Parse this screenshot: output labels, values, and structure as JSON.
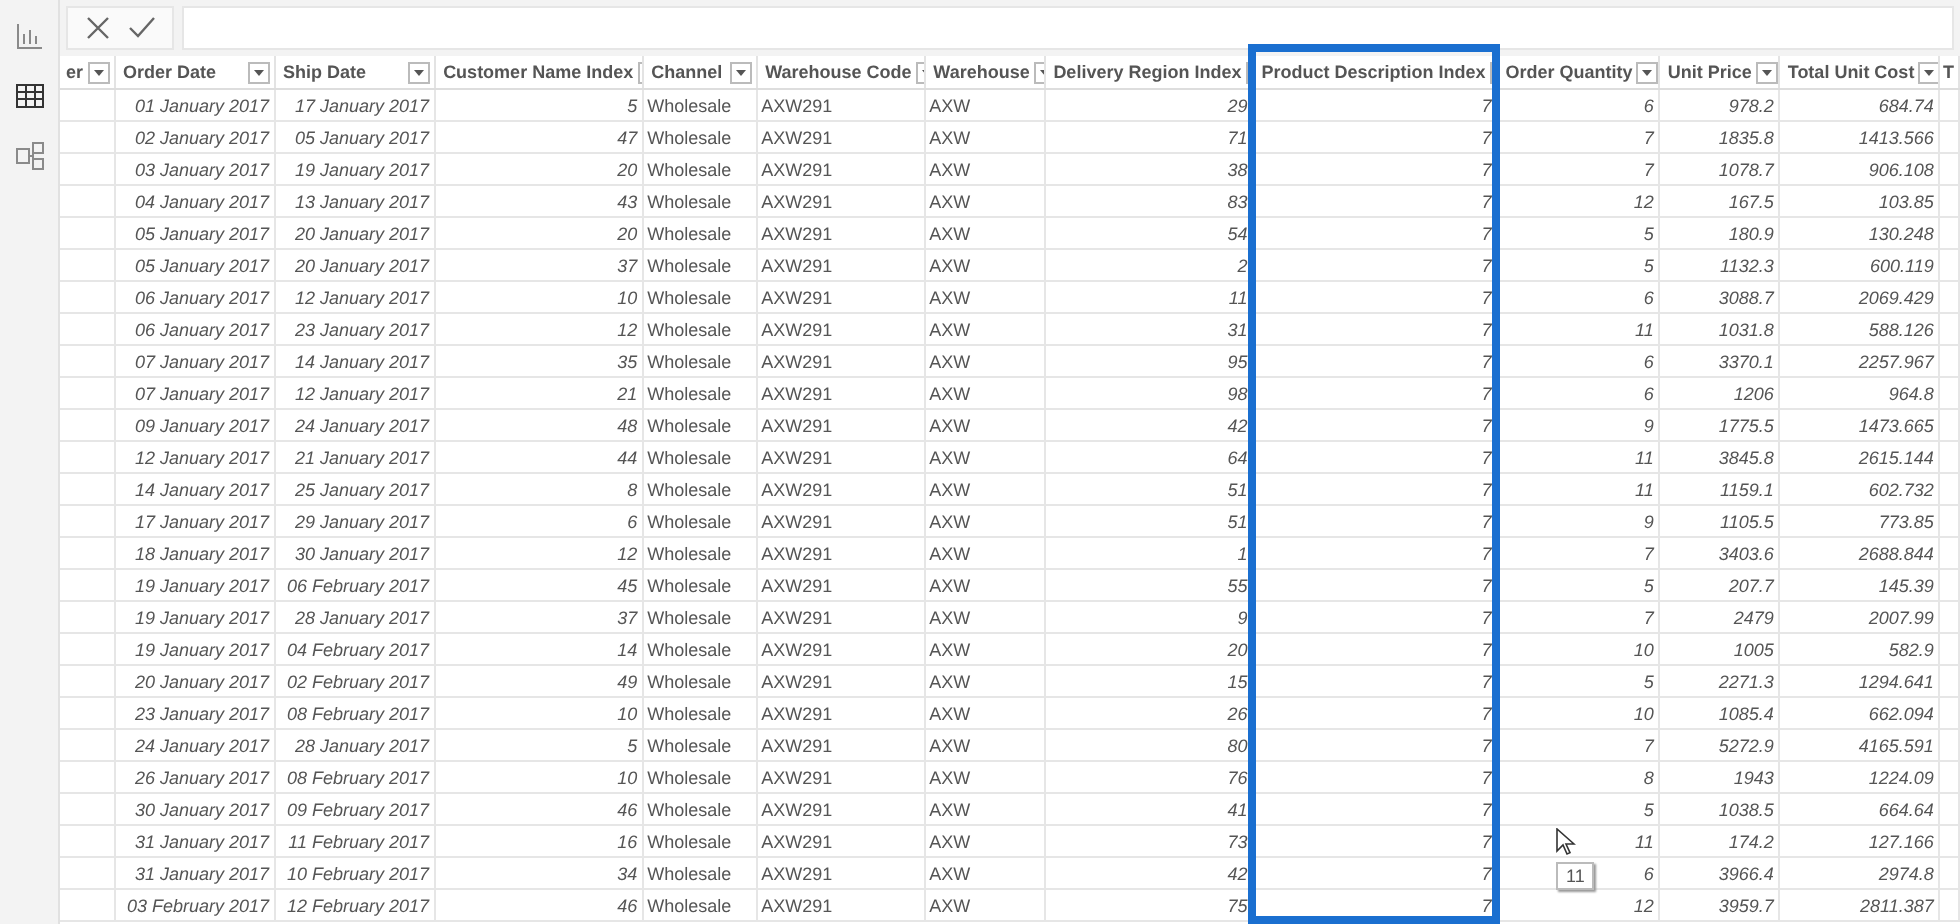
{
  "sidebar": {
    "items": [
      {
        "kind": "report",
        "selected": false
      },
      {
        "kind": "data",
        "selected": true
      },
      {
        "kind": "model",
        "selected": false
      }
    ]
  },
  "formula_bar": {
    "buttons": [
      {
        "kind": "cancel"
      },
      {
        "kind": "commit"
      }
    ]
  },
  "table": {
    "columns": [
      {
        "label": "er",
        "kind": "cut",
        "highlighted": false
      },
      {
        "label": "Order Date",
        "kind": "date",
        "highlighted": false
      },
      {
        "label": "Ship Date",
        "kind": "date",
        "highlighted": false
      },
      {
        "label": "Customer Name Index",
        "kind": "number",
        "highlighted": false
      },
      {
        "label": "Channel",
        "kind": "text",
        "highlighted": false
      },
      {
        "label": "Warehouse Code",
        "kind": "text",
        "highlighted": false
      },
      {
        "label": "Warehouse",
        "kind": "text",
        "highlighted": false
      },
      {
        "label": "Delivery Region Index",
        "kind": "number",
        "highlighted": false
      },
      {
        "label": "Product Description Index",
        "kind": "number",
        "highlighted": true
      },
      {
        "label": "Order Quantity",
        "kind": "number",
        "highlighted": false
      },
      {
        "label": "Unit Price",
        "kind": "number",
        "highlighted": false
      },
      {
        "label": "Total Unit Cost",
        "kind": "number",
        "highlighted": false
      },
      {
        "label": "T",
        "kind": "cut",
        "highlighted": false
      }
    ],
    "rows": [
      [
        "",
        "01 January 2017",
        "17 January 2017",
        "5",
        "Wholesale",
        "AXW291",
        "AXW",
        "29",
        "7",
        "6",
        "978.2",
        "684.74",
        ""
      ],
      [
        "",
        "02 January 2017",
        "05 January 2017",
        "47",
        "Wholesale",
        "AXW291",
        "AXW",
        "71",
        "7",
        "7",
        "1835.8",
        "1413.566",
        ""
      ],
      [
        "",
        "03 January 2017",
        "19 January 2017",
        "20",
        "Wholesale",
        "AXW291",
        "AXW",
        "38",
        "7",
        "7",
        "1078.7",
        "906.108",
        ""
      ],
      [
        "",
        "04 January 2017",
        "13 January 2017",
        "43",
        "Wholesale",
        "AXW291",
        "AXW",
        "83",
        "7",
        "12",
        "167.5",
        "103.85",
        ""
      ],
      [
        "",
        "05 January 2017",
        "20 January 2017",
        "20",
        "Wholesale",
        "AXW291",
        "AXW",
        "54",
        "7",
        "5",
        "180.9",
        "130.248",
        ""
      ],
      [
        "",
        "05 January 2017",
        "20 January 2017",
        "37",
        "Wholesale",
        "AXW291",
        "AXW",
        "2",
        "7",
        "5",
        "1132.3",
        "600.119",
        ""
      ],
      [
        "",
        "06 January 2017",
        "12 January 2017",
        "10",
        "Wholesale",
        "AXW291",
        "AXW",
        "11",
        "7",
        "6",
        "3088.7",
        "2069.429",
        ""
      ],
      [
        "",
        "06 January 2017",
        "23 January 2017",
        "12",
        "Wholesale",
        "AXW291",
        "AXW",
        "31",
        "7",
        "11",
        "1031.8",
        "588.126",
        ""
      ],
      [
        "",
        "07 January 2017",
        "14 January 2017",
        "35",
        "Wholesale",
        "AXW291",
        "AXW",
        "95",
        "7",
        "6",
        "3370.1",
        "2257.967",
        ""
      ],
      [
        "",
        "07 January 2017",
        "12 January 2017",
        "21",
        "Wholesale",
        "AXW291",
        "AXW",
        "98",
        "7",
        "6",
        "1206",
        "964.8",
        ""
      ],
      [
        "",
        "09 January 2017",
        "24 January 2017",
        "48",
        "Wholesale",
        "AXW291",
        "AXW",
        "42",
        "7",
        "9",
        "1775.5",
        "1473.665",
        ""
      ],
      [
        "",
        "12 January 2017",
        "21 January 2017",
        "44",
        "Wholesale",
        "AXW291",
        "AXW",
        "64",
        "7",
        "11",
        "3845.8",
        "2615.144",
        ""
      ],
      [
        "",
        "14 January 2017",
        "25 January 2017",
        "8",
        "Wholesale",
        "AXW291",
        "AXW",
        "51",
        "7",
        "11",
        "1159.1",
        "602.732",
        ""
      ],
      [
        "",
        "17 January 2017",
        "29 January 2017",
        "6",
        "Wholesale",
        "AXW291",
        "AXW",
        "51",
        "7",
        "9",
        "1105.5",
        "773.85",
        ""
      ],
      [
        "",
        "18 January 2017",
        "30 January 2017",
        "12",
        "Wholesale",
        "AXW291",
        "AXW",
        "1",
        "7",
        "7",
        "3403.6",
        "2688.844",
        ""
      ],
      [
        "",
        "19 January 2017",
        "06 February 2017",
        "45",
        "Wholesale",
        "AXW291",
        "AXW",
        "55",
        "7",
        "5",
        "207.7",
        "145.39",
        ""
      ],
      [
        "",
        "19 January 2017",
        "28 January 2017",
        "37",
        "Wholesale",
        "AXW291",
        "AXW",
        "9",
        "7",
        "7",
        "2479",
        "2007.99",
        ""
      ],
      [
        "",
        "19 January 2017",
        "04 February 2017",
        "14",
        "Wholesale",
        "AXW291",
        "AXW",
        "20",
        "7",
        "10",
        "1005",
        "582.9",
        ""
      ],
      [
        "",
        "20 January 2017",
        "02 February 2017",
        "49",
        "Wholesale",
        "AXW291",
        "AXW",
        "15",
        "7",
        "5",
        "2271.3",
        "1294.641",
        ""
      ],
      [
        "",
        "23 January 2017",
        "08 February 2017",
        "10",
        "Wholesale",
        "AXW291",
        "AXW",
        "26",
        "7",
        "10",
        "1085.4",
        "662.094",
        ""
      ],
      [
        "",
        "24 January 2017",
        "28 January 2017",
        "5",
        "Wholesale",
        "AXW291",
        "AXW",
        "80",
        "7",
        "7",
        "5272.9",
        "4165.591",
        ""
      ],
      [
        "",
        "26 January 2017",
        "08 February 2017",
        "10",
        "Wholesale",
        "AXW291",
        "AXW",
        "76",
        "7",
        "8",
        "1943",
        "1224.09",
        ""
      ],
      [
        "",
        "30 January 2017",
        "09 February 2017",
        "46",
        "Wholesale",
        "AXW291",
        "AXW",
        "41",
        "7",
        "5",
        "1038.5",
        "664.64",
        ""
      ],
      [
        "",
        "31 January 2017",
        "11 February 2017",
        "16",
        "Wholesale",
        "AXW291",
        "AXW",
        "73",
        "7",
        "11",
        "174.2",
        "127.166",
        ""
      ],
      [
        "",
        "31 January 2017",
        "10 February 2017",
        "34",
        "Wholesale",
        "AXW291",
        "AXW",
        "42",
        "7",
        "6",
        "3966.4",
        "2974.8",
        ""
      ],
      [
        "",
        "03 February 2017",
        "12 February 2017",
        "46",
        "Wholesale",
        "AXW291",
        "AXW",
        "75",
        "7",
        "12",
        "3959.7",
        "2811.387",
        ""
      ]
    ]
  },
  "tooltip": {
    "text": "11"
  }
}
